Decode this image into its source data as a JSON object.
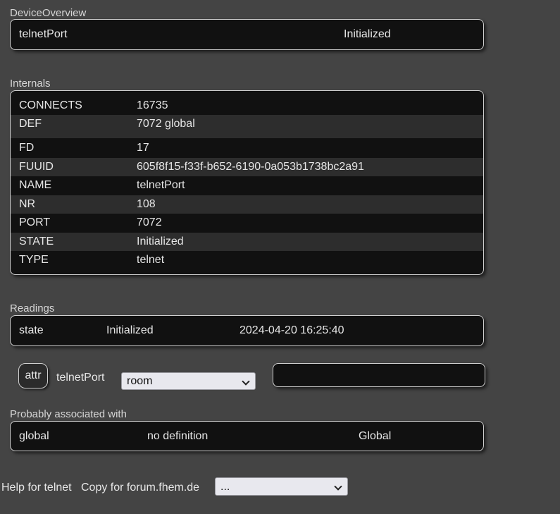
{
  "device_overview": {
    "title": "DeviceOverview",
    "name": "telnetPort",
    "state": "Initialized"
  },
  "internals": {
    "title": "Internals",
    "rows": [
      {
        "key": "CONNECTS",
        "value": "16735"
      },
      {
        "key": "DEF",
        "value": "7072 global"
      },
      {
        "key": "FD",
        "value": "17"
      },
      {
        "key": "FUUID",
        "value": "605f8f15-f33f-b652-6190-0a053b1738bc2a91"
      },
      {
        "key": "NAME",
        "value": "telnetPort"
      },
      {
        "key": "NR",
        "value": "108"
      },
      {
        "key": "PORT",
        "value": "7072"
      },
      {
        "key": "STATE",
        "value": "Initialized"
      },
      {
        "key": "TYPE",
        "value": "telnet"
      }
    ]
  },
  "readings": {
    "title": "Readings",
    "rows": [
      {
        "name": "state",
        "value": "Initialized",
        "timestamp": "2024-04-20 16:25:40"
      }
    ]
  },
  "attr_bar": {
    "button_label": "attr",
    "device": "telnetPort",
    "select_value": "room",
    "input_value": ""
  },
  "associated": {
    "title": "Probably associated with",
    "rows": [
      {
        "name": "global",
        "definition": "no definition",
        "type": "Global"
      }
    ]
  },
  "footer": {
    "help_label": "Help for telnet",
    "copy_label": "Copy for forum.fhem.de",
    "select_value": "..."
  }
}
